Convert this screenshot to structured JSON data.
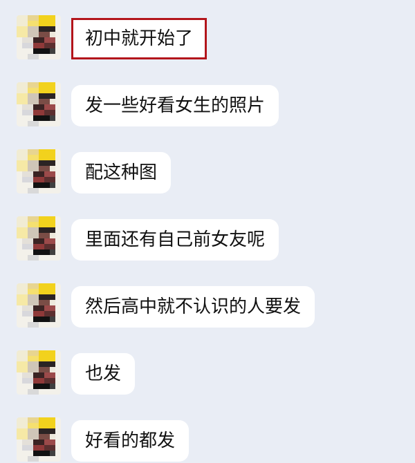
{
  "chat": {
    "highlight_color": "#b3151b",
    "messages": [
      {
        "text": "初中就开始了",
        "highlighted": true
      },
      {
        "text": "发一些好看女生的照片",
        "highlighted": false
      },
      {
        "text": "配这种图",
        "highlighted": false
      },
      {
        "text": "里面还有自己前女友呢",
        "highlighted": false
      },
      {
        "text": "然后高中就不认识的人要发",
        "highlighted": false
      },
      {
        "text": "也发",
        "highlighted": false
      },
      {
        "text": "好看的都发",
        "highlighted": false
      }
    ]
  }
}
